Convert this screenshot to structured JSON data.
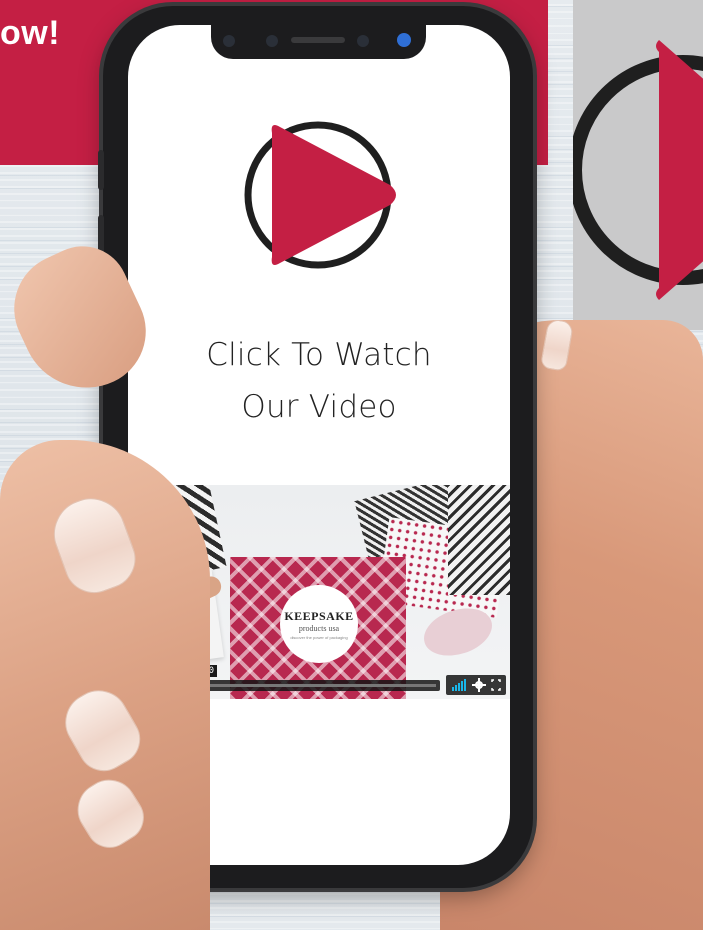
{
  "banner": {
    "text": "ow!",
    "color": "#c41f44"
  },
  "screen": {
    "cta_line1": "Click To Watch",
    "cta_line2": "Our Video",
    "play_logo_color": "#c41f44"
  },
  "video": {
    "brand_title": "KEEPSAKE",
    "brand_subtitle": "products usa",
    "brand_tagline": "discover the power of packaging",
    "duration": "02:00",
    "volume_icon": "volume-bars-icon",
    "settings_icon": "gear-icon",
    "fullscreen_icon": "fullscreen-icon"
  },
  "colors": {
    "accent": "#c41f44",
    "volume_accent": "#19b7ea"
  }
}
